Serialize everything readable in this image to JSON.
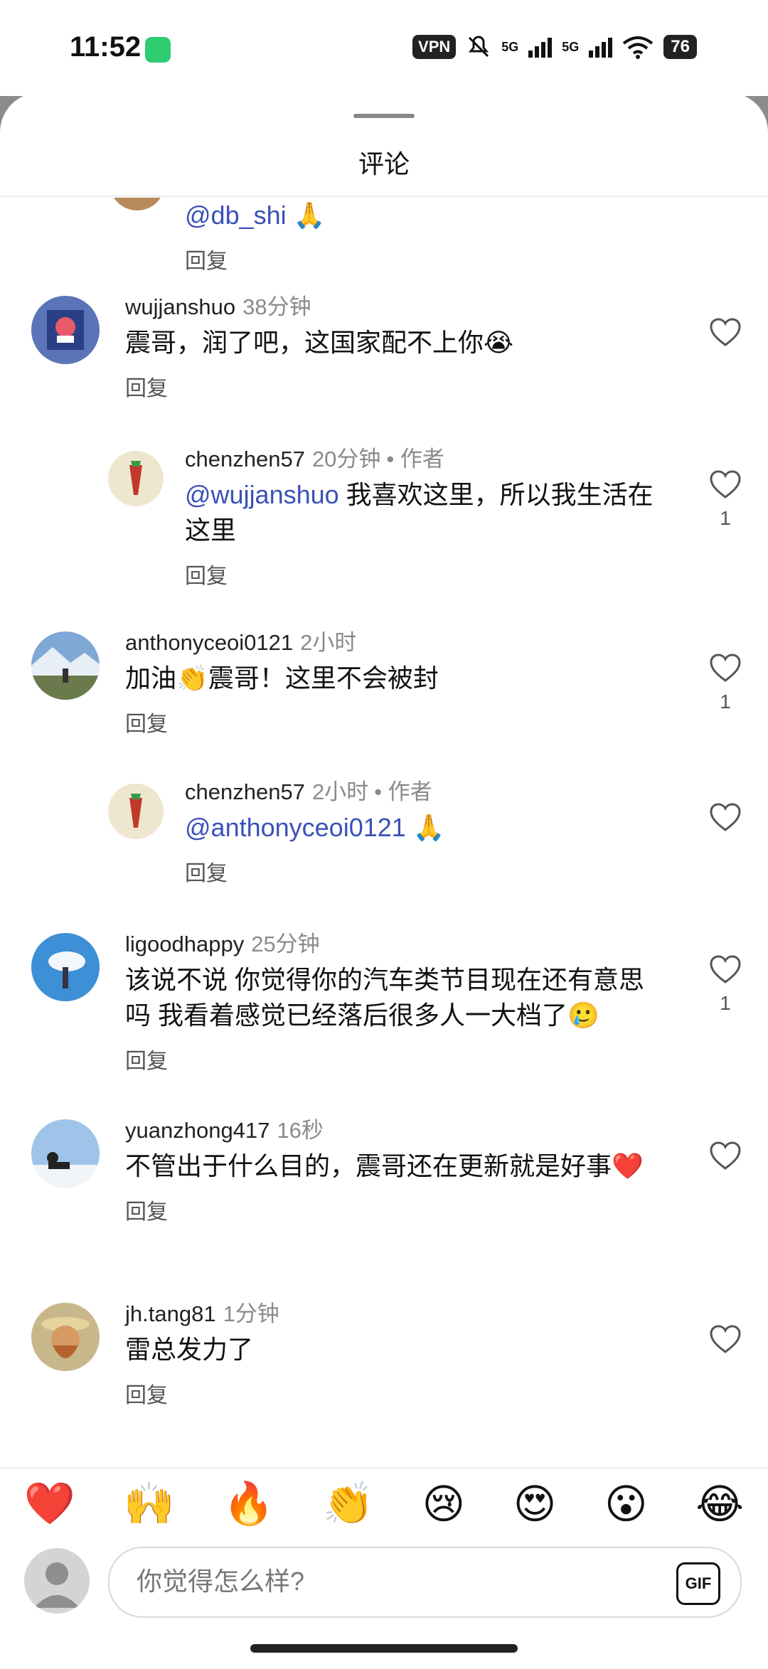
{
  "status_bar": {
    "time": "11:52",
    "vpn": "VPN",
    "network_1": "5G",
    "network_2": "5G",
    "battery": "76"
  },
  "sheet": {
    "title": "评论"
  },
  "comments": [
    {
      "mention": "@db_shi",
      "text": "🙏",
      "reply": "回复"
    },
    {
      "username": "wujjanshuo",
      "time": "38分钟",
      "text": "震哥，润了吧，这国家配不上你😭",
      "reply": "回复",
      "likes": ""
    },
    {
      "username": "chenzhen57",
      "time": "20分钟",
      "author_tag": "• 作者",
      "mention": "@wujjanshuo",
      "text": " 我喜欢这里，所以我生活在这里",
      "reply": "回复",
      "likes": "1"
    },
    {
      "username": "anthonyceoi0121",
      "time": "2小时",
      "text": "加油👏震哥！这里不会被封",
      "reply": "回复",
      "likes": "1"
    },
    {
      "username": "chenzhen57",
      "time": "2小时",
      "author_tag": "• 作者",
      "mention": "@anthonyceoi0121",
      "text": " 🙏",
      "reply": "回复",
      "likes": ""
    },
    {
      "username": "ligoodhappy",
      "time": "25分钟",
      "text": "该说不说 你觉得你的汽车类节目现在还有意思吗 我看着感觉已经落后很多人一大档了🥲",
      "reply": "回复",
      "likes": "1"
    },
    {
      "username": "yuanzhong417",
      "time": "16秒",
      "text": "不管出于什么目的，震哥还在更新就是好事❤️",
      "reply": "回复",
      "likes": ""
    },
    {
      "username": "jh.tang81",
      "time": "1分钟",
      "text": "雷总发力了",
      "reply": "回复",
      "likes": ""
    }
  ],
  "reactions": [
    "❤️",
    "🙌",
    "🔥",
    "👏",
    "😢",
    "😍",
    "😮",
    "😂"
  ],
  "composer": {
    "placeholder": "你觉得怎么样?",
    "gif_label": "GIF"
  },
  "colors": {
    "mention": "#3a51b8",
    "sheet_bg": "#ffffff",
    "scrim": "#8c8c8c"
  }
}
